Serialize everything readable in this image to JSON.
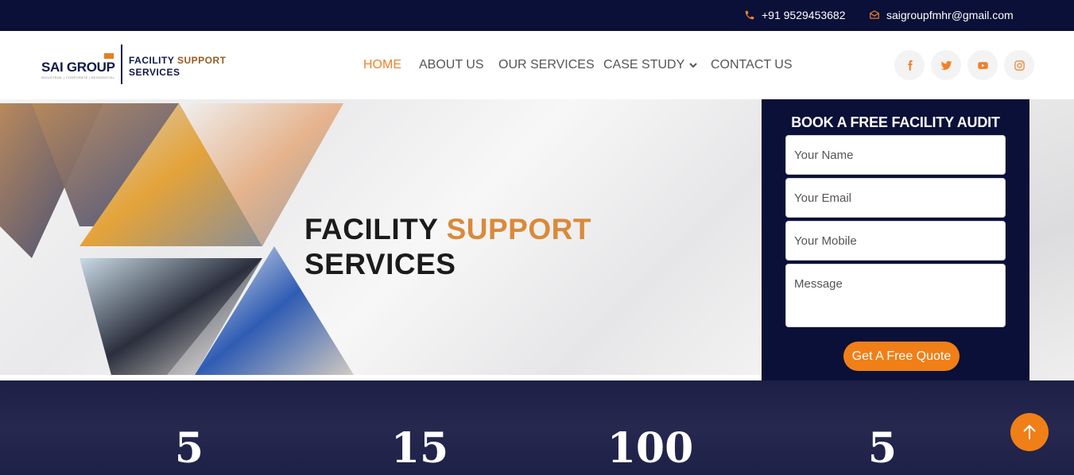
{
  "topbar": {
    "phone": "+91 9529453682",
    "email": "saigroupfmhr@gmail.com"
  },
  "logo": {
    "brand": "SAI GROUP",
    "tagline": "INDUSTRIAL | CORPORATE | RESIDENTIAL",
    "line1_a": "FACILITY",
    "line1_b": "SUPPORT",
    "line2": "SERVICES"
  },
  "nav": {
    "home": "HOME",
    "about": "ABOUT US",
    "services": "OUR SERVICES",
    "case_study": "CASE STUDY",
    "contact": "CONTACT US"
  },
  "social": [
    "facebook-icon",
    "twitter-icon",
    "youtube-icon",
    "instagram-icon"
  ],
  "hero": {
    "line1_a": "FACILITY",
    "line1_b": "SUPPORT",
    "line2": "SERVICES"
  },
  "form": {
    "title": "BOOK A FREE FACILITY AUDIT",
    "name_placeholder": "Your Name",
    "email_placeholder": "Your Email",
    "mobile_placeholder": "Your Mobile",
    "message_placeholder": "Message",
    "submit": "Get A Free Quote"
  },
  "stats": [
    "5",
    "15",
    "100",
    "5"
  ],
  "colors": {
    "navy": "#0b1038",
    "accent": "#f07f17"
  }
}
